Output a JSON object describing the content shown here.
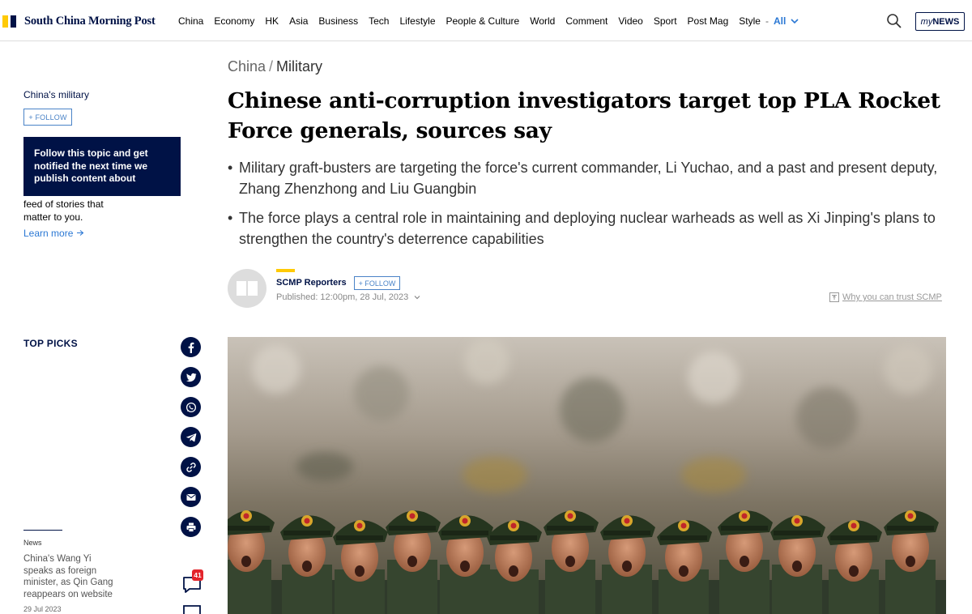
{
  "header": {
    "logo_text": "South China Morning Post",
    "nav": [
      "China",
      "Economy",
      "HK",
      "Asia",
      "Business",
      "Tech",
      "Lifestyle",
      "People & Culture",
      "World",
      "Comment",
      "Video",
      "Sport",
      "Post Mag",
      "Style"
    ],
    "nav_dash": "-",
    "all_label": "All",
    "mynews_prefix": "my",
    "mynews_suffix": "NEWS"
  },
  "left": {
    "topic": "China's military",
    "follow_label": "+ FOLLOW",
    "tooltip": "Follow this topic and get notified the next time we publish content about",
    "feed_text": "feed of stories that matter to you.",
    "learn_more": "Learn more"
  },
  "top_picks": {
    "heading": "TOP PICKS",
    "category": "News",
    "title": "China's Wang Yi speaks as foreign minister, as Qin Gang reappears on website",
    "date": "29 Jul 2023"
  },
  "share": {
    "comment_count": "41"
  },
  "article": {
    "breadcrumb_section": "China",
    "breadcrumb_sep": "/",
    "breadcrumb_current": "Military",
    "headline": "Chinese anti-corruption investigators target top PLA Rocket Force generals, sources say",
    "summary": [
      "Military graft-busters are targeting the force's current commander, Li Yuchao, and a past and present deputy, Zhang Zhenzhong and Liu Guangbin",
      "The force plays a central role in maintaining and deploying nuclear warheads as well as Xi Jinping's plans to strengthen the country's deterrence capabilities"
    ],
    "bullet": "•",
    "author": "SCMP Reporters",
    "author_follow": "+ FOLLOW",
    "published": "Published: 12:00pm, 28 Jul, 2023",
    "trust_link": "Why you can trust SCMP"
  },
  "colors": {
    "brand_navy": "#001246",
    "brand_yellow": "#ffca05",
    "link_blue": "#2b78d4",
    "badge_red": "#e3242b"
  },
  "icons": [
    "search-icon",
    "facebook-icon",
    "twitter-icon",
    "whatsapp-icon",
    "telegram-icon",
    "link-icon",
    "email-icon",
    "print-icon",
    "comment-icon"
  ]
}
